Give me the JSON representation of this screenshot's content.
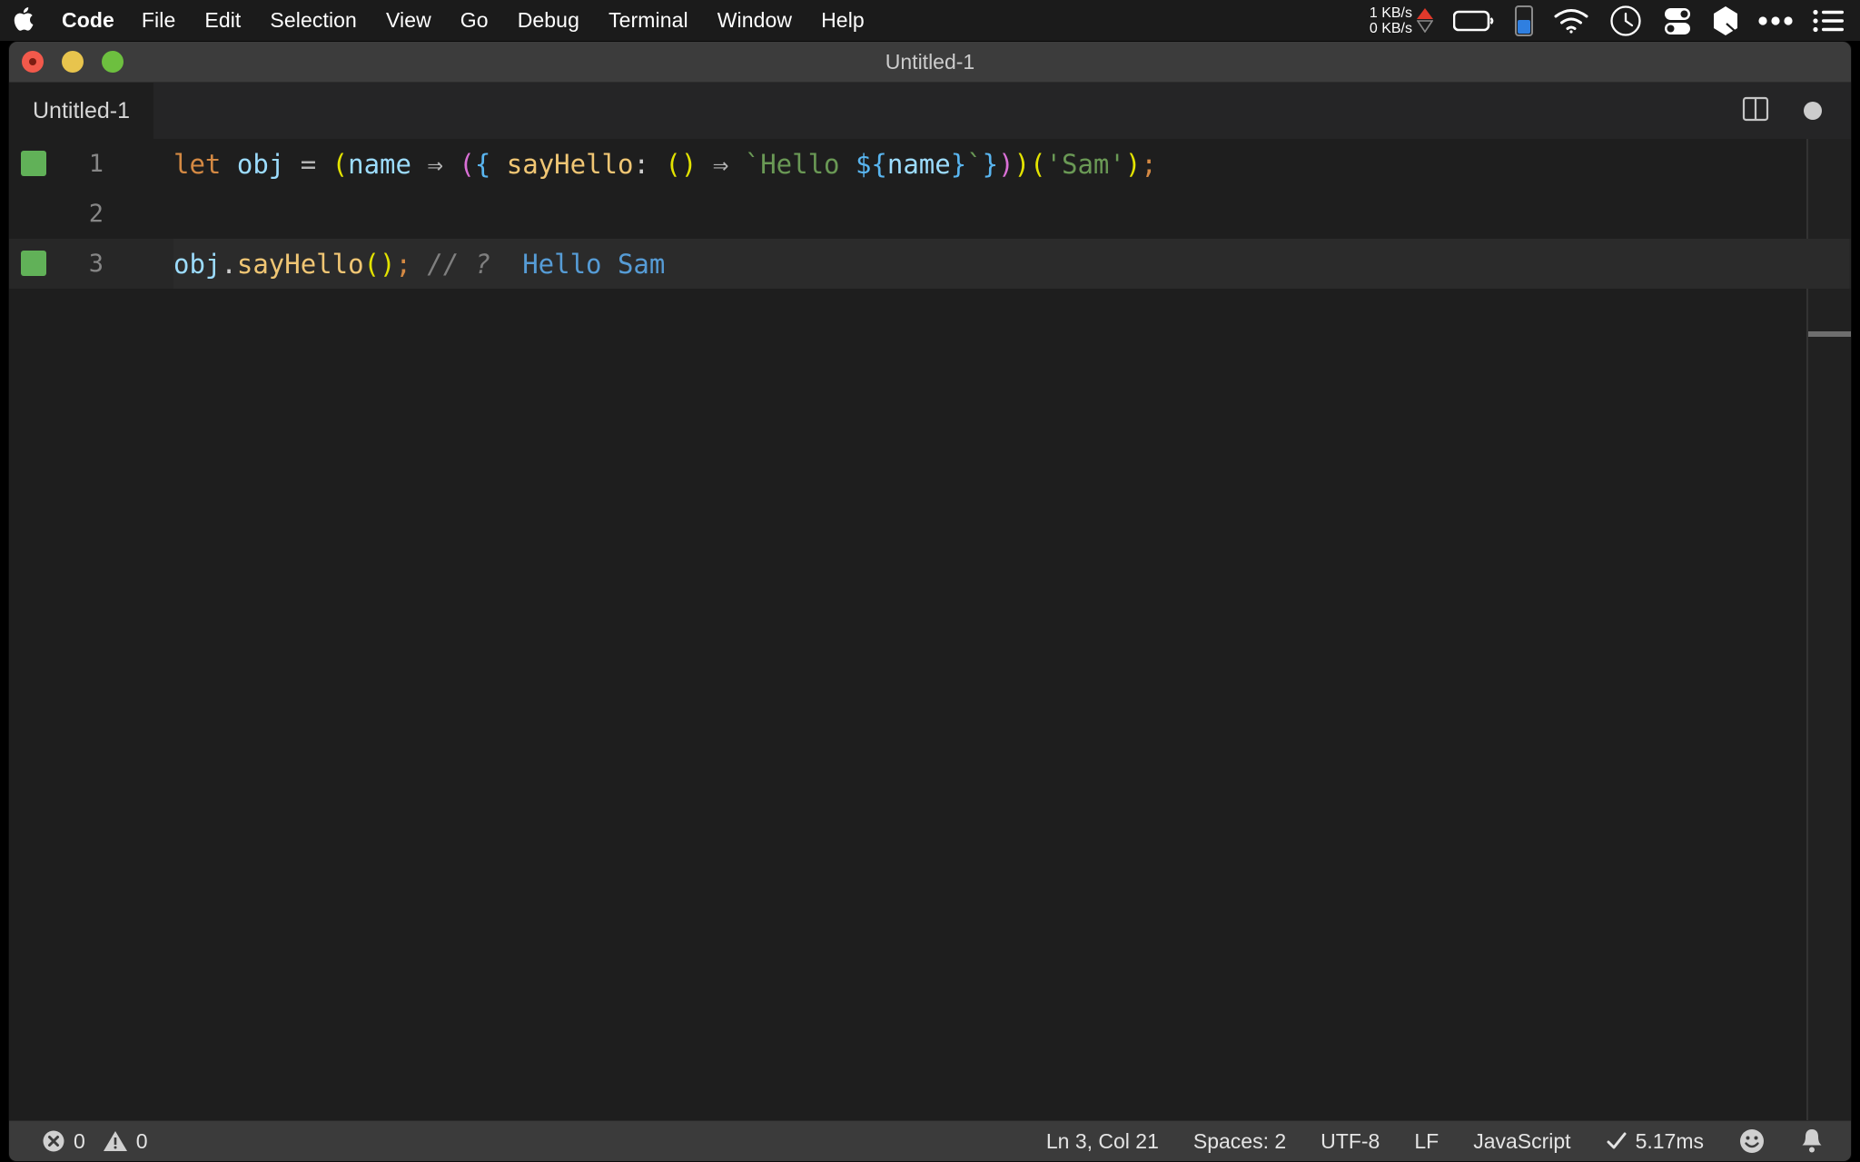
{
  "menubar": {
    "apple_icon": "apple-logo-icon",
    "items": [
      {
        "label": "Code",
        "bold": true
      },
      {
        "label": "File",
        "bold": false
      },
      {
        "label": "Edit",
        "bold": false
      },
      {
        "label": "Selection",
        "bold": false
      },
      {
        "label": "View",
        "bold": false
      },
      {
        "label": "Go",
        "bold": false
      },
      {
        "label": "Debug",
        "bold": false
      },
      {
        "label": "Terminal",
        "bold": false
      },
      {
        "label": "Window",
        "bold": false
      },
      {
        "label": "Help",
        "bold": false
      }
    ],
    "network": {
      "upload": "1 KB/s",
      "download": "0 KB/s",
      "up_arrow_color": "#e0392b",
      "down_arrow_color": "#8a8a8a"
    },
    "status_icons": [
      "battery-icon",
      "battery-level-indicator-icon",
      "wifi-icon",
      "clock-icon",
      "toggles-icon",
      "shape-icon",
      "ellipsis-icon",
      "list-menu-icon"
    ]
  },
  "window": {
    "title": "Untitled-1",
    "traffic_lights": [
      "close-button",
      "minimize-button",
      "zoom-button"
    ]
  },
  "tabs": {
    "active": "Untitled-1",
    "items": [
      {
        "label": "Untitled-1"
      }
    ],
    "actions": [
      "split-editor-icon",
      "unsaved-dirty-indicator"
    ]
  },
  "editor": {
    "language": "JavaScript",
    "lines": [
      {
        "number": "1",
        "marker": true,
        "highlight": false
      },
      {
        "number": "2",
        "marker": false,
        "highlight": false
      },
      {
        "number": "3",
        "marker": true,
        "highlight": true
      }
    ],
    "line1_tokens": [
      {
        "text": "let",
        "cls": "t-kw"
      },
      {
        "text": " ",
        "cls": "t-punc"
      },
      {
        "text": "obj",
        "cls": "t-var"
      },
      {
        "text": " ",
        "cls": "t-punc"
      },
      {
        "text": "=",
        "cls": "t-op"
      },
      {
        "text": " ",
        "cls": "t-punc"
      },
      {
        "text": "(",
        "cls": "t-paren-y"
      },
      {
        "text": "name",
        "cls": "t-var"
      },
      {
        "text": " ",
        "cls": "t-punc"
      },
      {
        "text": "⇒",
        "cls": "t-arrow"
      },
      {
        "text": " ",
        "cls": "t-punc"
      },
      {
        "text": "(",
        "cls": "t-paren-m"
      },
      {
        "text": "{",
        "cls": "t-paren-b"
      },
      {
        "text": " ",
        "cls": "t-punc"
      },
      {
        "text": "sayHello",
        "cls": "t-prop"
      },
      {
        "text": ":",
        "cls": "t-punc"
      },
      {
        "text": " ",
        "cls": "t-punc"
      },
      {
        "text": "(",
        "cls": "t-paren-y"
      },
      {
        "text": ")",
        "cls": "t-paren-y"
      },
      {
        "text": " ",
        "cls": "t-punc"
      },
      {
        "text": "⇒",
        "cls": "t-arrow"
      },
      {
        "text": " ",
        "cls": "t-punc"
      },
      {
        "text": "`Hello ",
        "cls": "t-tmpl"
      },
      {
        "text": "${",
        "cls": "t-paren-b"
      },
      {
        "text": "name",
        "cls": "t-var"
      },
      {
        "text": "}",
        "cls": "t-paren-b"
      },
      {
        "text": "`",
        "cls": "t-tmpl"
      },
      {
        "text": "}",
        "cls": "t-paren-b"
      },
      {
        "text": ")",
        "cls": "t-paren-m"
      },
      {
        "text": ")",
        "cls": "t-paren-y"
      },
      {
        "text": "(",
        "cls": "t-paren-y"
      },
      {
        "text": "'Sam'",
        "cls": "t-str"
      },
      {
        "text": ")",
        "cls": "t-paren-y"
      },
      {
        "text": ";",
        "cls": "t-semi"
      }
    ],
    "line3_tokens": [
      {
        "text": "obj",
        "cls": "t-var"
      },
      {
        "text": ".",
        "cls": "t-punc"
      },
      {
        "text": "sayHello",
        "cls": "t-prop"
      },
      {
        "text": "(",
        "cls": "t-paren-y"
      },
      {
        "text": ")",
        "cls": "t-paren-y"
      },
      {
        "text": ";",
        "cls": "t-semi"
      },
      {
        "text": " ",
        "cls": "t-punc"
      },
      {
        "text": "// ?",
        "cls": "t-comment"
      },
      {
        "text": "  ",
        "cls": "t-punc"
      },
      {
        "text": "Hello Sam",
        "cls": "t-result"
      }
    ]
  },
  "statusbar": {
    "errors_icon": "error-circle-icon",
    "errors_count": "0",
    "warnings_icon": "warning-triangle-icon",
    "warnings_count": "0",
    "cursor_position": "Ln 3, Col 21",
    "indentation": "Spaces: 2",
    "encoding": "UTF-8",
    "eol": "LF",
    "language_mode": "JavaScript",
    "run_status_icon": "check-icon",
    "run_status": "5.17ms",
    "feedback_icon": "smiley-icon",
    "notifications_icon": "bell-icon"
  },
  "colors": {
    "menubar_bg": "#1b1b1b",
    "titlebar_bg": "#3c3c3c",
    "tabbar_bg": "#252526",
    "editor_bg": "#1e1e1e",
    "statusbar_bg": "#3b3b3b",
    "marker_green": "#61b158",
    "result_blue": "#569cd6"
  }
}
